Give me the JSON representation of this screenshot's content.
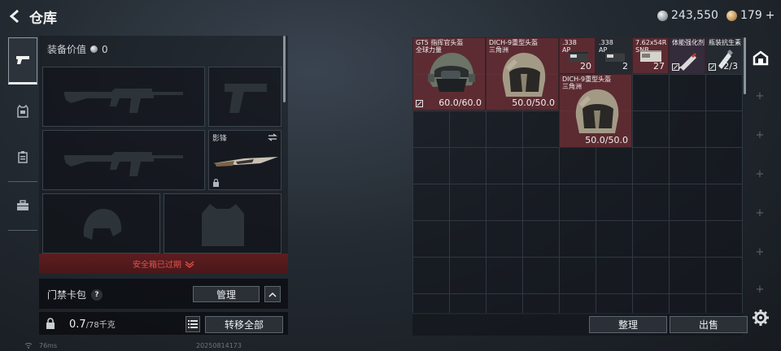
{
  "header": {
    "title": "仓库"
  },
  "currency": {
    "silver": "243,550",
    "gold": "179",
    "gold_plus": "+"
  },
  "equipment": {
    "value_label": "装备价值",
    "value": "0",
    "knife_slot_label": "影锋",
    "expired_notice": "安全箱已过期",
    "card_pack_label": "门禁卡包",
    "help_label": "?",
    "manage_button": "管理",
    "weight": "0.7",
    "weight_max": "/78千克",
    "transfer_all_button": "转移全部"
  },
  "storage": {
    "items": [
      {
        "name": "GT5 指挥官头盔\n全球力量",
        "value": "60.0/60.0"
      },
      {
        "name": "DICH-9重型头盔\n三角洲",
        "value": "50.0/50.0"
      },
      {
        "name": ".338\nAP",
        "value": "20"
      },
      {
        "name": ".338\nAP",
        "value": "2"
      },
      {
        "name": "7.62x54R\nSNB",
        "value": "27"
      },
      {
        "name": "体能强化剂",
        "value": ""
      },
      {
        "name": "瓶装抗生素",
        "value": "2/3"
      },
      {
        "name": "DICH-9重型头盔\n三角洲",
        "value": "50.0/50.0"
      }
    ],
    "sort_button": "整理",
    "sell_button": "出售"
  },
  "footer": {
    "ping": "76ms",
    "build": "20250814173"
  },
  "colors": {
    "accent_red": "#e0524b",
    "item_red": "#703036"
  }
}
